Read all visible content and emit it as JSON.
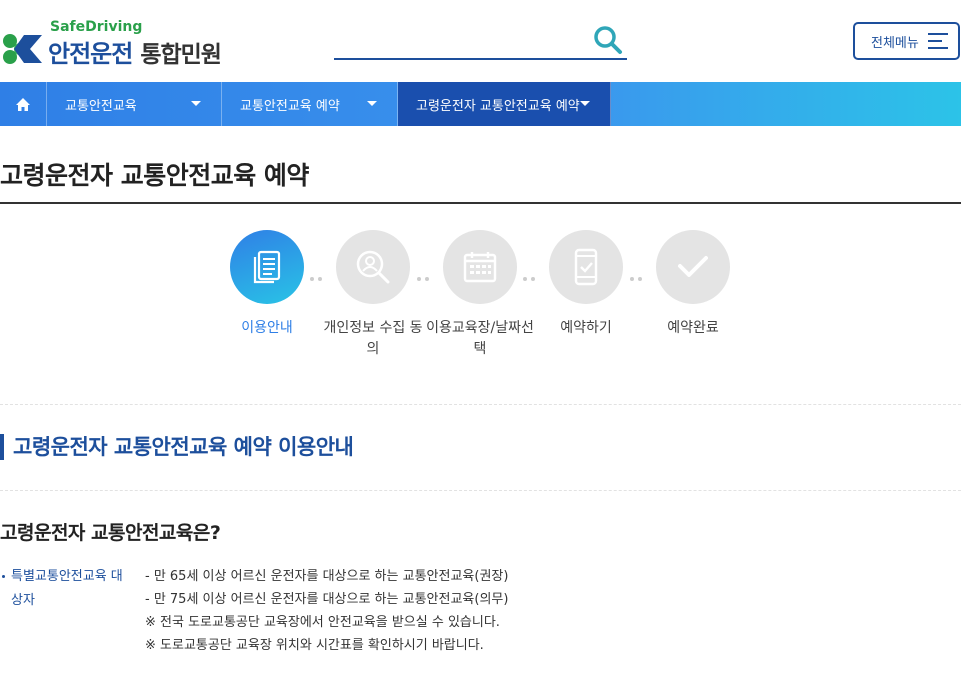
{
  "header": {
    "logo_en": "SafeDriving",
    "logo_ko_main": "안전운전",
    "logo_ko_sub": "통합민원",
    "search_placeholder": "",
    "all_menu_label": "전체메뉴"
  },
  "nav": {
    "items": [
      {
        "label": "교통안전교육"
      },
      {
        "label": "교통안전교육 예약"
      },
      {
        "label": "고령운전자 교통안전교육 예약"
      }
    ]
  },
  "page": {
    "title": "고령운전자 교통안전교육 예약"
  },
  "steps": [
    {
      "label": "이용안내",
      "icon": "document-icon",
      "active": true
    },
    {
      "label": "개인정보 수집 동의",
      "icon": "search-person-icon",
      "active": false
    },
    {
      "label": "이용교육장/날짜선택",
      "icon": "calendar-icon",
      "active": false
    },
    {
      "label": "예약하기",
      "icon": "phone-check-icon",
      "active": false
    },
    {
      "label": "예약완료",
      "icon": "check-icon",
      "active": false
    }
  ],
  "section": {
    "title": "고령운전자 교통안전교육 예약 이용안내",
    "question": "고령운전자 교통안전교육은?",
    "info_head": "특별교통안전교육 대상자",
    "info_lines": [
      "- 만 65세 이상 어르신 운전자를 대상으로 하는 교통안전교육(권장)",
      "- 만 75세 이상 어르신 운전자를 대상으로 하는 교통안전교육(의무)",
      "※ 전국 도로교통공단 교육장에서 안전교육을 받으실 수 있습니다.",
      "※ 도로교통공단 교육장 위치와 시간표를 확인하시기 바랍니다."
    ]
  },
  "colors": {
    "brand_blue": "#1d4f9c",
    "accent_blue": "#2f7fe6",
    "brand_green": "#2aa04a"
  }
}
